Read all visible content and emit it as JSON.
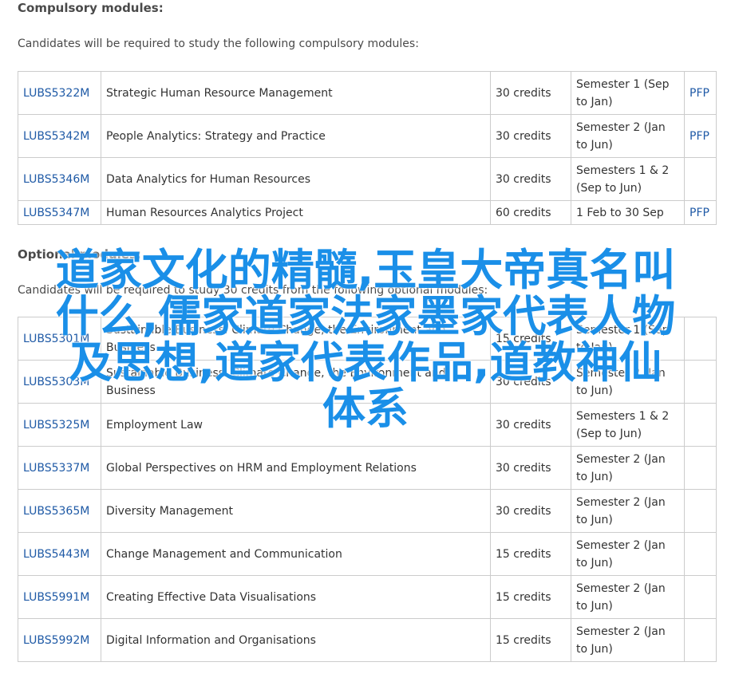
{
  "compulsory": {
    "heading": "Compulsory modules:",
    "intro": "Candidates will be required to study the following compulsory modules:",
    "rows": [
      {
        "code": "LUBS5322M",
        "title": "Strategic Human Resource Management",
        "credits": "30 credits",
        "semester": "Semester 1 (Sep to Jan)",
        "pfp": "PFP"
      },
      {
        "code": "LUBS5342M",
        "title": "People Analytics: Strategy and Practice",
        "credits": "30 credits",
        "semester": "Semester 2 (Jan to Jun)",
        "pfp": "PFP"
      },
      {
        "code": "LUBS5346M",
        "title": "Data Analytics for Human Resources",
        "credits": "30 credits",
        "semester": "Semesters 1 & 2 (Sep to Jun)",
        "pfp": ""
      },
      {
        "code": "LUBS5347M",
        "title": "Human Resources Analytics Project",
        "credits": "60 credits",
        "semester": "1 Feb to 30 Sep",
        "pfp": "PFP"
      }
    ]
  },
  "optional": {
    "heading": "Optional modules:",
    "intro": "Candidates will be required to study 30 credits from the following optional modules:",
    "rows": [
      {
        "code": "LUBS5301M",
        "title": "Sustainable Business: Climate Change, the Environment and Business",
        "credits": "15 credits",
        "semester": "Semester 1 (Sep to Jan)",
        "pfp": ""
      },
      {
        "code": "LUBS5303M",
        "title": "Sustainable Business: Climate Change, the Environment and Business",
        "credits": "30 credits",
        "semester": "Semester 2 (Jan to Jun)",
        "pfp": ""
      },
      {
        "code": "LUBS5325M",
        "title": "Employment Law",
        "credits": "30 credits",
        "semester": "Semesters 1 & 2 (Sep to Jun)",
        "pfp": ""
      },
      {
        "code": "LUBS5337M",
        "title": "Global Perspectives on HRM and Employment Relations",
        "credits": "30 credits",
        "semester": "Semester 2 (Jan to Jun)",
        "pfp": ""
      },
      {
        "code": "LUBS5365M",
        "title": "Diversity Management",
        "credits": "30 credits",
        "semester": "Semester 2 (Jan to Jun)",
        "pfp": ""
      },
      {
        "code": "LUBS5443M",
        "title": "Change Management and Communication",
        "credits": "15 credits",
        "semester": "Semester 2 (Jan to Jun)",
        "pfp": ""
      },
      {
        "code": "LUBS5991M",
        "title": "Creating Effective Data Visualisations",
        "credits": "15 credits",
        "semester": "Semester 2 (Jan to Jun)",
        "pfp": ""
      },
      {
        "code": "LUBS5992M",
        "title": "Digital Information and Organisations",
        "credits": "15 credits",
        "semester": "Semester 2 (Jan to Jun)",
        "pfp": ""
      }
    ]
  },
  "overlay": {
    "lines": [
      "道家文化的精髓,玉皇大帝真名叫",
      "什么,儒家道家法家墨家代表人物",
      "及思想,道家代表作品,道教神仙",
      "体系"
    ],
    "color": "#1a8fe8"
  },
  "colors": {
    "link": "#1f5aa6",
    "border": "#cccccc",
    "text": "#333333"
  }
}
